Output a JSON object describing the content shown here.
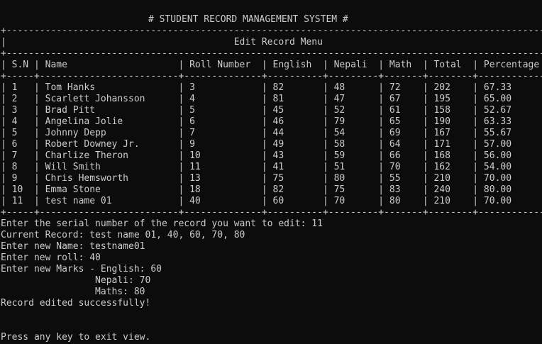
{
  "title": "# STUDENT RECORD MANAGEMENT SYSTEM #",
  "menu_title": "Edit Record Menu",
  "table": {
    "columns": [
      "S.N",
      "Name",
      "Roll Number",
      "English",
      "Nepali",
      "Math",
      "Total",
      "Percentage"
    ],
    "rows": [
      [
        "1",
        "Tom Hanks",
        "3",
        "82",
        "48",
        "72",
        "202",
        "67.33"
      ],
      [
        "2",
        "Scarlett Johansson",
        "4",
        "81",
        "47",
        "67",
        "195",
        "65.00"
      ],
      [
        "3",
        "Brad Pitt",
        "5",
        "45",
        "52",
        "61",
        "158",
        "52.67"
      ],
      [
        "4",
        "Angelina Jolie",
        "6",
        "46",
        "79",
        "65",
        "190",
        "63.33"
      ],
      [
        "5",
        "Johnny Depp",
        "7",
        "44",
        "54",
        "69",
        "167",
        "55.67"
      ],
      [
        "6",
        "Robert Downey Jr.",
        "9",
        "49",
        "58",
        "64",
        "171",
        "57.00"
      ],
      [
        "7",
        "Charlize Theron",
        "10",
        "43",
        "59",
        "66",
        "168",
        "56.00"
      ],
      [
        "8",
        "Will Smith",
        "11",
        "41",
        "51",
        "70",
        "162",
        "54.00"
      ],
      [
        "9",
        "Chris Hemsworth",
        "13",
        "75",
        "80",
        "55",
        "210",
        "70.00"
      ],
      [
        "10",
        "Emma Stone",
        "18",
        "82",
        "75",
        "83",
        "240",
        "80.00"
      ],
      [
        "11",
        "test name 01",
        "40",
        "60",
        "70",
        "80",
        "210",
        "70.00"
      ]
    ]
  },
  "console_lines": [
    "Enter the serial number of the record you want to edit: 11",
    "Current Record: test name 01, 40, 60, 70, 80",
    "Enter new Name: testname01",
    "Enter new roll: 40",
    "Enter new Marks - English: 60",
    "                 Nepali: 70",
    "                 Maths: 80",
    "Record edited successfully!"
  ],
  "footer": "Press any key to exit view.",
  "colors": {
    "background": "#0c0c0c",
    "text": "#cccccc"
  }
}
